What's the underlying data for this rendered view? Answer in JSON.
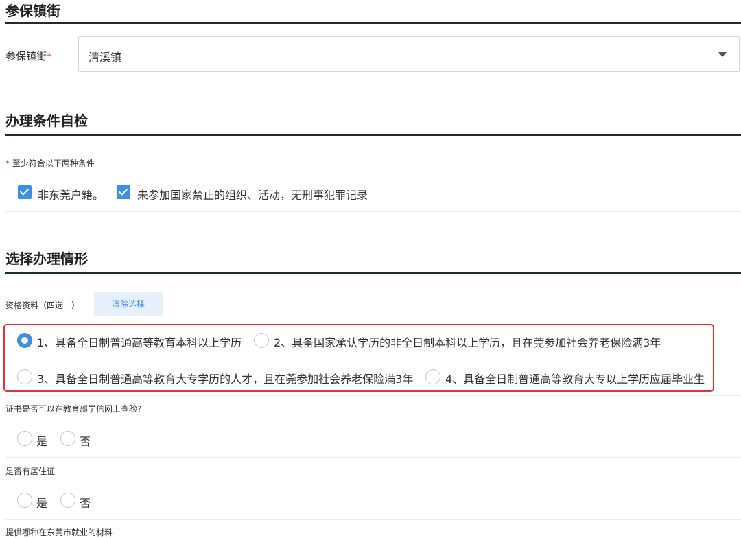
{
  "section1": {
    "title": "参保镇街",
    "field_label": "参保镇街",
    "required_mark": "*",
    "selected_value": "清溪镇",
    "caret_icon": "chevron-down-icon"
  },
  "section2": {
    "title": "办理条件自检",
    "required_mark": "*",
    "note": "至少符合以下两种条件",
    "checkboxes": [
      {
        "label": "非东莞户籍。",
        "checked": true
      },
      {
        "label": "未参加国家禁止的组织、活动，无刑事犯罪记录",
        "checked": true
      }
    ]
  },
  "section3": {
    "title": "选择办理情形",
    "qualification_label": "资格资料（四选一）",
    "clear_button": "清除选择",
    "options": [
      {
        "label": "1、具备全日制普通高等教育本科以上学历",
        "selected": true
      },
      {
        "label": "2、具备国家承认学历的非全日制本科以上学历，且在莞参加社会养老保险满3年",
        "selected": false
      },
      {
        "label": "3、具备全日制普通高等教育大专学历的人才，且在莞参加社会养老保险满3年",
        "selected": false
      },
      {
        "label": "4、具备全日制普通高等教育大专以上学历应届毕业生",
        "selected": false
      }
    ],
    "q1": {
      "label": "证书是否可以在教育部学信网上查验?",
      "yes": "是",
      "no": "否"
    },
    "q2": {
      "label": "是否有居住证",
      "yes": "是",
      "no": "否"
    },
    "q3": {
      "label": "提供哪种在东莞市就业的材料"
    }
  },
  "colors": {
    "accent": "#3d8fe0",
    "highlight": "#e8302c",
    "rule": "#1f2a36"
  }
}
